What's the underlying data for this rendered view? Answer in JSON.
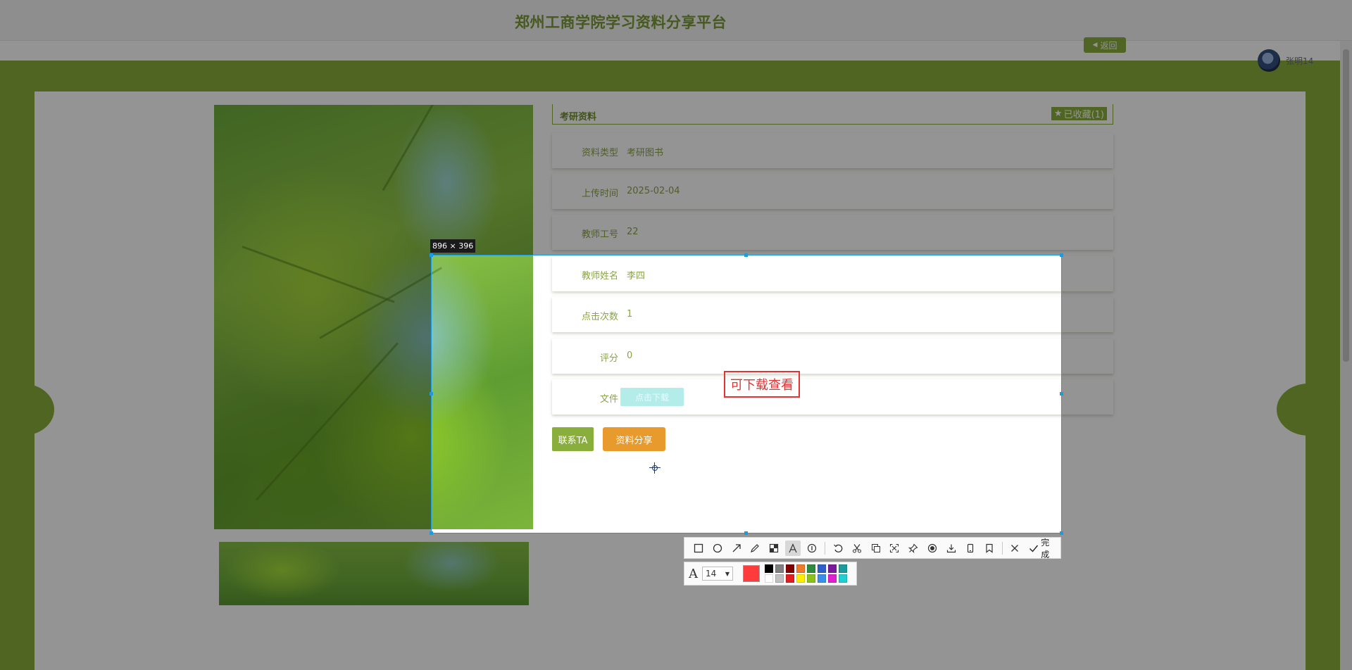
{
  "header": {
    "site_title": "郑州工商学院学习资料分享平台",
    "back_label": "返回",
    "user_name": "张明14"
  },
  "detail": {
    "category": "考研资料",
    "favorite_label": "已收藏(1)",
    "rows": [
      {
        "label": "资料类型",
        "value": "考研图书"
      },
      {
        "label": "上传时间",
        "value": "2025-02-04"
      },
      {
        "label": "教师工号",
        "value": "22"
      },
      {
        "label": "教师姓名",
        "value": "李四"
      },
      {
        "label": "点击次数",
        "value": "1"
      },
      {
        "label": "评分",
        "value": "0"
      },
      {
        "label": "文件",
        "value": ""
      }
    ],
    "download_label": "点击下载",
    "contact_label": "联系TA",
    "share_label": "资料分享"
  },
  "capture": {
    "size_label": "896 × 396",
    "annotation_text": "可下载查看",
    "tools": [
      "rectangle-icon",
      "ellipse-icon",
      "arrow-icon",
      "pencil-icon",
      "mosaic-icon",
      "text-icon",
      "number-icon",
      "undo-icon",
      "cut-icon",
      "copy-icon",
      "scroll-capture-icon",
      "pin-icon",
      "record-icon",
      "save-icon",
      "phone-icon",
      "bookmark-icon",
      "close-icon"
    ],
    "active_tool": "text-icon",
    "done_label": "完成",
    "font_size": "14",
    "current_color": "#ff3b3b",
    "palette": [
      "#000000",
      "#808080",
      "#800000",
      "#f07a2c",
      "#2e8b3d",
      "#2f5fc9",
      "#7a1a9a",
      "#1a9a9a",
      "#ffffff",
      "#c0c0c0",
      "#e02020",
      "#ffee00",
      "#8bc21a",
      "#3a8fe8",
      "#e020d0",
      "#20d0d0"
    ]
  },
  "colors": {
    "brand_green": "#8aae3b",
    "share_orange": "#e89a2c",
    "selection_blue": "#1a9be6",
    "annotation_red": "#e53333"
  }
}
